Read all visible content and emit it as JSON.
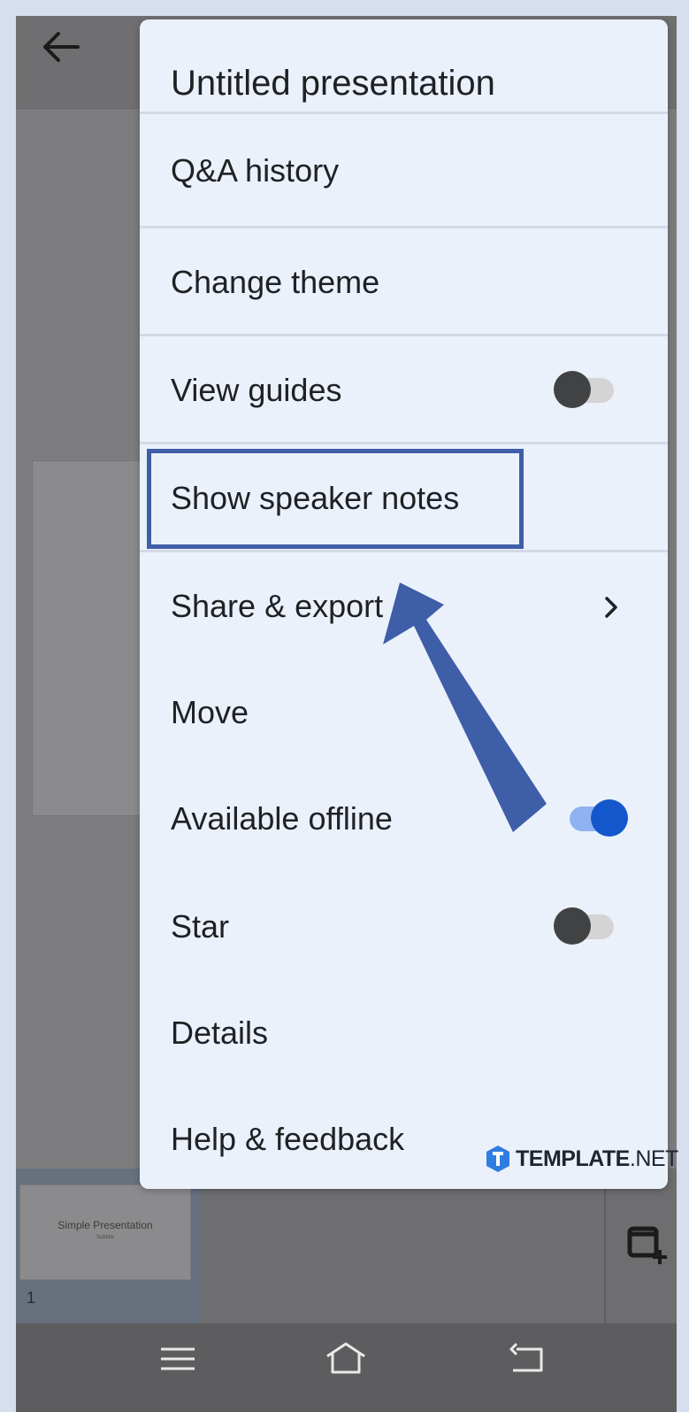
{
  "menu": {
    "title": "Untitled presentation",
    "items": [
      {
        "label": "Q&A history"
      },
      {
        "label": "Change theme"
      },
      {
        "label": "View guides",
        "toggle": "off"
      },
      {
        "label": "Show speaker notes"
      },
      {
        "label": "Share & export",
        "chevron": "chevron-right-icon"
      },
      {
        "label": "Move"
      },
      {
        "label": "Available offline",
        "toggle": "on"
      },
      {
        "label": "Star",
        "toggle": "off"
      },
      {
        "label": "Details"
      },
      {
        "label": "Help & feedback"
      }
    ]
  },
  "background_app": {
    "thumbnail": {
      "title": "Simple Presentation",
      "subtitle": "Subtitle",
      "slide_number": "1"
    }
  },
  "annotation": {
    "highlighted_item": "Show speaker notes",
    "color": "#3f5ea8"
  },
  "watermark": {
    "brand": "TEMPLATE",
    "suffix": ".NET",
    "badge_letter": "T"
  },
  "colors": {
    "menu_bg": "#ebf1fb",
    "toggle_on": "#1457cc",
    "toggle_on_track": "#8fb3f0",
    "toggle_off_knob": "#414244",
    "annotation": "#3f5ea8"
  }
}
